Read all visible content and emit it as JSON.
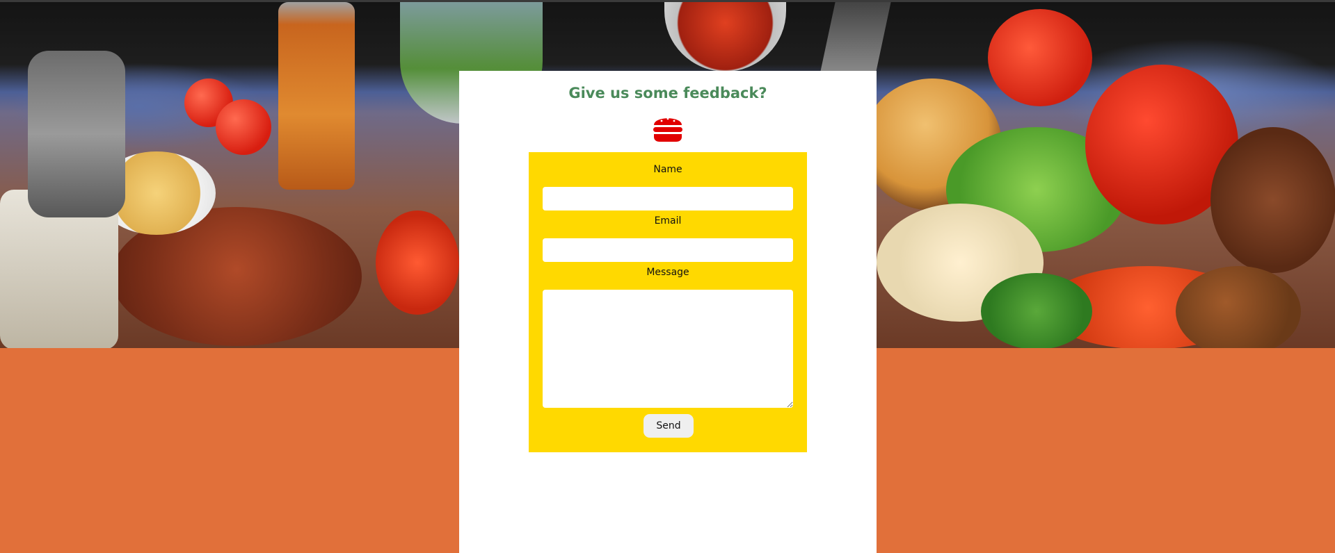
{
  "form_panel": {
    "title": "Give us some feedback?",
    "logo_icon": "burger-icon",
    "fields": [
      {
        "label": "Name",
        "value": "",
        "placeholder": ""
      },
      {
        "label": "Email",
        "value": "",
        "placeholder": ""
      },
      {
        "label": "Message",
        "value": "",
        "placeholder": ""
      }
    ],
    "submit_label": "Send"
  },
  "colors": {
    "page_background": "#e1703a",
    "form_background": "#ffd900",
    "title_color": "#4a8a5a",
    "logo_color": "#e10000",
    "panel_background": "#ffffff"
  },
  "hero_image": {
    "description_icon": "food-illustration-banner"
  }
}
